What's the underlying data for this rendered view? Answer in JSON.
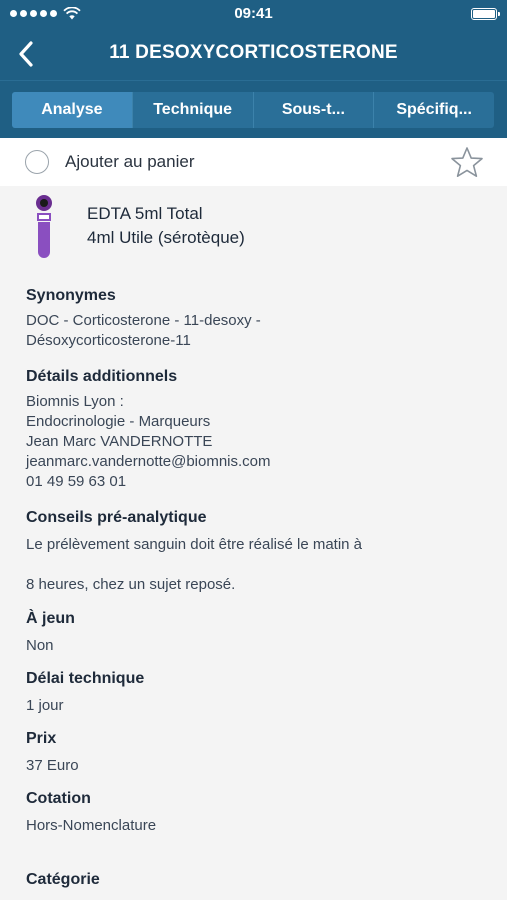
{
  "status_bar": {
    "time": "09:41"
  },
  "nav": {
    "title": "11 DESOXYCORTICOSTERONE"
  },
  "tabs": [
    {
      "label": "Analyse",
      "active": true
    },
    {
      "label": "Technique",
      "active": false
    },
    {
      "label": "Sous-t...",
      "active": false
    },
    {
      "label": "Spécifiq...",
      "active": false
    }
  ],
  "cart": {
    "label": "Ajouter au panier",
    "checked": false
  },
  "tube": {
    "line1": "EDTA 5ml Total",
    "line2": "4ml Utile (sérotèque)",
    "cap_color": "#7b3fa0"
  },
  "sections": {
    "synonymes": {
      "title": "Synonymes",
      "lines": [
        "DOC - Corticosterone - 11-desoxy -",
        "Désoxycorticosterone-11"
      ]
    },
    "details": {
      "title": "Détails additionnels",
      "lines": [
        "Biomnis Lyon :",
        "Endocrinologie - Marqueurs",
        "Jean Marc VANDERNOTTE",
        "jeanmarc.vandernotte@biomnis.com",
        "01 49 59 63 01"
      ]
    },
    "conseils": {
      "title": "Conseils pré-analytique",
      "line1": "Le prélèvement sanguin doit être réalisé le matin à",
      "line2": "8 heures, chez un sujet reposé."
    },
    "jeun": {
      "title": "À jeun",
      "value": "Non"
    },
    "delai": {
      "title": "Délai technique",
      "value": "1 jour"
    },
    "prix": {
      "title": "Prix",
      "value": "37 Euro"
    },
    "cotation": {
      "title": "Cotation",
      "value": "Hors-Nomenclature"
    },
    "categorie": {
      "title": "Catégorie"
    }
  },
  "colors": {
    "header": "#1f5f84",
    "tab_active": "#3f8abb",
    "tab_bg": "#2a6f98",
    "tube": "#8a4fc0"
  }
}
